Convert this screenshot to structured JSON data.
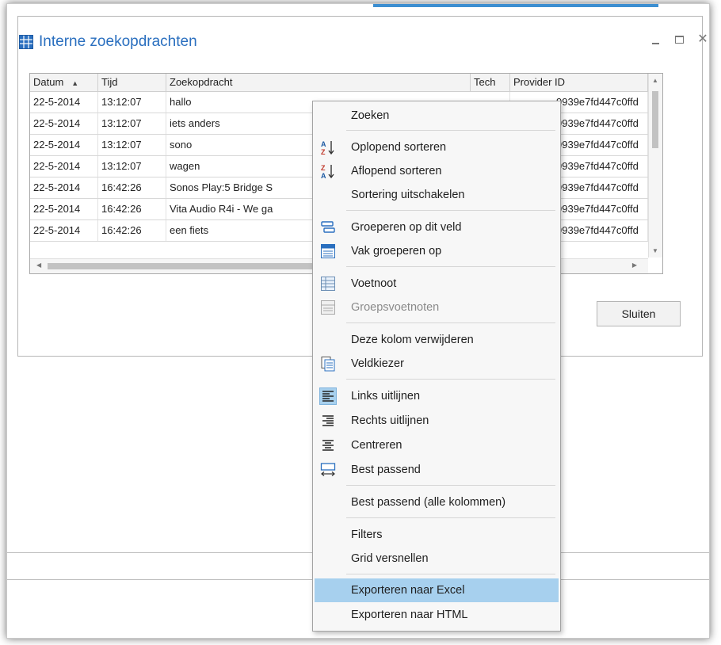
{
  "dialog": {
    "title": "Interne zoekopdrachten",
    "close_label": "Sluiten",
    "close_glyph": "✕",
    "minimize_icon": "minimize-icon",
    "maximize_icon": "maximize-icon"
  },
  "grid": {
    "columns": [
      "Datum",
      "Tijd",
      "Zoekopdracht",
      "Tech",
      "Provider ID"
    ],
    "sort_indicator": "▲",
    "rows": [
      {
        "datum": "22-5-2014",
        "tijd": "13:12:07",
        "zoek": "hallo",
        "id": "9939e7fd447c0ffd"
      },
      {
        "datum": "22-5-2014",
        "tijd": "13:12:07",
        "zoek": "iets anders",
        "id": "9939e7fd447c0ffd"
      },
      {
        "datum": "22-5-2014",
        "tijd": "13:12:07",
        "zoek": "sono",
        "id": "9939e7fd447c0ffd"
      },
      {
        "datum": "22-5-2014",
        "tijd": "13:12:07",
        "zoek": "wagen",
        "id": "9939e7fd447c0ffd"
      },
      {
        "datum": "22-5-2014",
        "tijd": "16:42:26",
        "zoek": "Sonos Play:5  Bridge S",
        "id": "9939e7fd447c0ffd"
      },
      {
        "datum": "22-5-2014",
        "tijd": "16:42:26",
        "zoek": "Vita Audio R4i - We ga",
        "id": "9939e7fd447c0ffd"
      },
      {
        "datum": "22-5-2014",
        "tijd": "16:42:26",
        "zoek": "een fiets",
        "id": "9939e7fd447c0ffd"
      }
    ]
  },
  "context_menu": {
    "items": [
      {
        "label": "Zoeken",
        "icon": ""
      },
      {
        "label": "Oplopend sorteren",
        "icon": "sort-ascending-icon"
      },
      {
        "label": "Aflopend sorteren",
        "icon": "sort-descending-icon"
      },
      {
        "label": "Sortering uitschakelen",
        "icon": ""
      },
      {
        "label": "Groeperen op dit veld",
        "icon": "group-by-field-icon"
      },
      {
        "label": "Vak groeperen op",
        "icon": "group-box-icon"
      },
      {
        "label": "Voetnoot",
        "icon": "footer-icon"
      },
      {
        "label": "Groepsvoetnoten",
        "icon": "group-footer-icon",
        "disabled": true
      },
      {
        "label": "Deze kolom verwijderen",
        "icon": ""
      },
      {
        "label": "Veldkiezer",
        "icon": "field-chooser-icon"
      },
      {
        "label": "Links uitlijnen",
        "icon": "align-left-icon",
        "checked": true
      },
      {
        "label": "Rechts uitlijnen",
        "icon": "align-right-icon"
      },
      {
        "label": "Centreren",
        "icon": "align-center-icon"
      },
      {
        "label": "Best passend",
        "icon": "best-fit-icon"
      },
      {
        "label": "Best passend (alle kolommen)",
        "icon": ""
      },
      {
        "label": "Filters",
        "icon": ""
      },
      {
        "label": "Grid versnellen",
        "icon": ""
      },
      {
        "label": "Exporteren naar Excel",
        "icon": "",
        "highlighted": true
      },
      {
        "label": "Exporteren naar HTML",
        "icon": ""
      }
    ]
  },
  "colors": {
    "accent": "#2a6fbf",
    "highlight": "#a7d0ee"
  }
}
